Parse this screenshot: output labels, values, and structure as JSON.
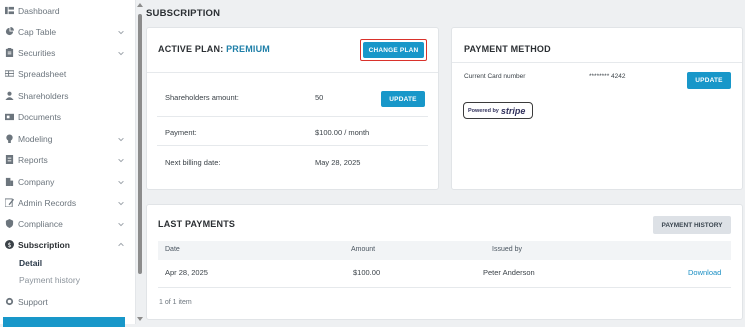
{
  "sidebar": {
    "items": [
      {
        "label": "Dashboard",
        "icon": "dashboard-icon",
        "chevron": false
      },
      {
        "label": "Cap Table",
        "icon": "pie-chart-icon",
        "chevron": true
      },
      {
        "label": "Securities",
        "icon": "clipboard-icon",
        "chevron": true
      },
      {
        "label": "Spreadsheet",
        "icon": "spreadsheet-icon",
        "chevron": false
      },
      {
        "label": "Shareholders",
        "icon": "user-icon",
        "chevron": false
      },
      {
        "label": "Documents",
        "icon": "folder-icon",
        "chevron": false
      },
      {
        "label": "Modeling",
        "icon": "lightbulb-icon",
        "chevron": true
      },
      {
        "label": "Reports",
        "icon": "report-icon",
        "chevron": true
      },
      {
        "label": "Company",
        "icon": "building-icon",
        "chevron": true
      },
      {
        "label": "Admin Records",
        "icon": "edit-icon",
        "chevron": true
      },
      {
        "label": "Compliance",
        "icon": "shield-icon",
        "chevron": true
      },
      {
        "label": "Subscription",
        "icon": "dollar-icon",
        "chevron": true
      }
    ],
    "sub_items": [
      "Detail",
      "Payment history"
    ],
    "support_label": "Support"
  },
  "page": {
    "title": "SUBSCRIPTION"
  },
  "plan": {
    "title": "ACTIVE PLAN:",
    "name": "PREMIUM",
    "change_label": "CHANGE PLAN",
    "shareholders_label": "Shareholders amount:",
    "shareholders_value": "50",
    "update_label": "UPDATE",
    "payment_label": "Payment:",
    "payment_value": "$100.00 / month",
    "billing_label": "Next billing date:",
    "billing_value": "May 28, 2025"
  },
  "payment_method": {
    "title": "PAYMENT METHOD",
    "card_label": "Current Card number",
    "card_value": "******** 4242",
    "update_label": "UPDATE",
    "powered_by": "Powered by",
    "stripe": "stripe"
  },
  "last_payments": {
    "title": "LAST PAYMENTS",
    "history_label": "PAYMENT HISTORY",
    "columns": [
      "Date",
      "Amount",
      "Issued by"
    ],
    "rows": [
      {
        "date": "Apr 28, 2025",
        "amount": "$100.00",
        "issued_by": "Peter Anderson",
        "action": "Download"
      }
    ],
    "footer": "1 of 1 item"
  },
  "colors": {
    "accent": "#1897c9",
    "highlight": "#d9322b",
    "plan_name": "#1e7fa8"
  }
}
